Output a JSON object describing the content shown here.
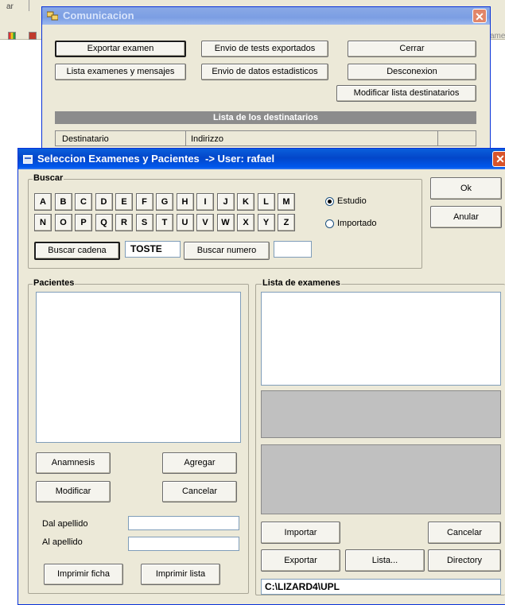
{
  "background": {
    "left_fragment": "ar",
    "right_fragment": "ame"
  },
  "comunicacion": {
    "title": "Comunicacion",
    "buttons": {
      "exportar_examen": "Exportar examen",
      "envio_tests": "Envio de tests exportados",
      "cerrar": "Cerrar",
      "lista_examenes_mensajes": "Lista examenes y mensajes",
      "envio_datos": "Envio de datos estadisticos",
      "desconexion": "Desconexion",
      "modificar_lista": "Modificar lista destinatarios"
    },
    "section_header": "Lista de los destinatarios",
    "columns": [
      "Destinatario",
      "Indirizzo"
    ]
  },
  "seleccion": {
    "title": "Seleccion Examenes y Pacientes  -> User: rafael",
    "buscar": {
      "label": "Buscar",
      "letters_row1": [
        "A",
        "B",
        "C",
        "D",
        "E",
        "F",
        "G",
        "H",
        "I",
        "J",
        "K",
        "L",
        "M"
      ],
      "letters_row2": [
        "N",
        "O",
        "P",
        "Q",
        "R",
        "S",
        "T",
        "U",
        "V",
        "W",
        "X",
        "Y",
        "Z"
      ],
      "radio_estudio": "Estudio",
      "radio_importado": "Importado",
      "buscar_cadena": "Buscar cadena",
      "search_value": "TOSTE",
      "buscar_numero": "Buscar numero",
      "numero_value": ""
    },
    "ok": "Ok",
    "anular": "Anular",
    "pacientes": {
      "label": "Pacientes",
      "anamnesis": "Anamnesis",
      "agregar": "Agregar",
      "modificar": "Modificar",
      "cancelar": "Cancelar",
      "dal_apellido": "Dal apellido",
      "al_apellido": "Al apellido",
      "dal_value": "",
      "al_value": "",
      "imprimir_ficha": "Imprimir ficha",
      "imprimir_lista": "Imprimir lista"
    },
    "examenes": {
      "label": "Lista de examenes",
      "importar": "Importar",
      "cancelar": "Cancelar",
      "exportar": "Exportar",
      "lista": "Lista...",
      "directory": "Directory",
      "path": "C:\\LIZARD4\\UPL"
    }
  }
}
